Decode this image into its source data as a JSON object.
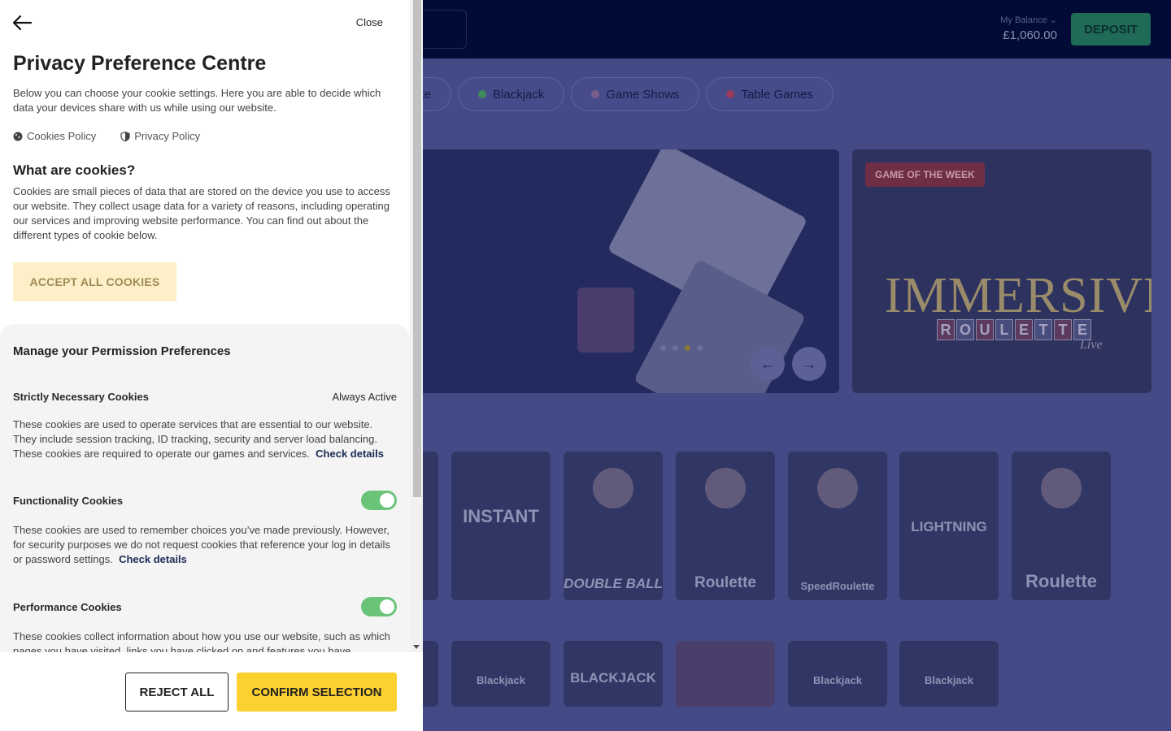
{
  "site": {
    "balance_label": "My Balance",
    "balance_amount": "£1,060.00",
    "deposit_label": "DEPOSIT",
    "chips": [
      {
        "label": "ette",
        "color": "#6a6fa0"
      },
      {
        "label": "Blackjack",
        "color": "#3d8a5e"
      },
      {
        "label": "Game Shows",
        "color": "#7a5c8a"
      },
      {
        "label": "Table Games",
        "color": "#9a3a5a"
      }
    ],
    "prev_arrow": "←",
    "next_arrow": "→",
    "game_of_week_badge": "GAME OF THE WEEK",
    "game_of_week_title": "IMMERSIVE",
    "game_of_week_sub": [
      "R",
      "O",
      "U",
      "L",
      "E",
      "T",
      "T",
      "E"
    ],
    "game_of_week_tag": "Live",
    "tiles_row1": [
      "",
      "INSTANT",
      "DOUBLE BALL",
      "Roulette",
      "SpeedRoulette",
      "LIGHTNING",
      "Roulette"
    ],
    "tiles_row2": [
      "",
      "Blackjack",
      "BLACKJACK",
      "",
      "Blackjack",
      "Blackjack"
    ]
  },
  "panel": {
    "close_label": "Close",
    "title": "Privacy Preference Centre",
    "intro": "Below you can choose your cookie settings. Here you are able to decide which data your devices share with us while using our website.",
    "links": {
      "cookies_policy": "Cookies Policy",
      "privacy_policy": "Privacy Policy"
    },
    "what_title": "What are cookies?",
    "what_text": "Cookies are small pieces of data that are stored on the device you use to access our website. They collect usage data for a variety of reasons, including operating our services and improving website performance. You can find out about the different types of cookie below.",
    "accept_all": "ACCEPT ALL COOKIES",
    "prefs_title": "Manage your Permission Preferences",
    "strict": {
      "name": "Strictly Necessary Cookies",
      "status": "Always Active",
      "desc": "These cookies are used to operate services that are essential to our website. They include session tracking, ID tracking, security and server load balancing. These cookies are required to operate our games and services.",
      "link": "Check details"
    },
    "functionality": {
      "name": "Functionality Cookies",
      "enabled": true,
      "desc": "These cookies are used to remember choices you’ve made previously. However, for security purposes we do not request cookies that reference your log in details or password settings.",
      "link": "Check details"
    },
    "performance": {
      "name": "Performance Cookies",
      "enabled": true,
      "desc": "These cookies collect information about how you use our website, such as which pages you have visited, links you have clicked on and features you have"
    },
    "reject_all": "REJECT ALL",
    "confirm": "CONFIRM SELECTION"
  }
}
